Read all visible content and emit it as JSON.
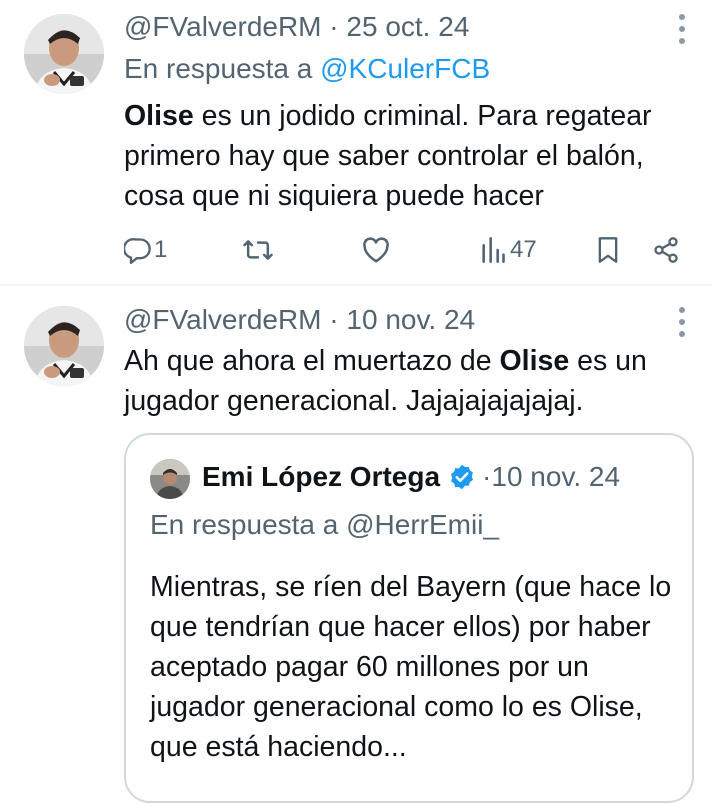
{
  "tweets": [
    {
      "handle": "@FValverdeRM",
      "date": "25 oct. 24",
      "reply_prefix": "En respuesta a ",
      "reply_to": "@KCulerFCB",
      "bold_word": "Olise",
      "text_rest": " es un jodido criminal. Para regatear primero hay que saber controlar el balón, cosa que ni siquiera puede hacer",
      "reply_count": "1",
      "views": "47"
    },
    {
      "handle": "@FValverdeRM",
      "date": "10 nov. 24",
      "text_before": "Ah que ahora el muertazo de ",
      "bold_word": "Olise",
      "text_after": " es un jugador generacional. Jajajajajajajaj.",
      "quote": {
        "name": "Emi López Ortega",
        "date": "10 nov. 24",
        "reply_line": "En respuesta a @HerrEmii_",
        "text": "Mientras, se ríen del Bayern (que hace lo que tendrían que hacer ellos) por haber aceptado pagar 60 millones por un jugador generacional como lo es Olise, que está haciendo..."
      }
    }
  ],
  "separator": " · ",
  "colors": {
    "text": "#0f1419",
    "secondary": "#536471",
    "link": "#1d9bf0",
    "verified": "#1d9bf0"
  },
  "icons": [
    "avatar",
    "more-icon",
    "reply-icon",
    "retweet-icon",
    "like-icon",
    "views-icon",
    "bookmark-icon",
    "share-icon",
    "verified-badge-icon"
  ]
}
